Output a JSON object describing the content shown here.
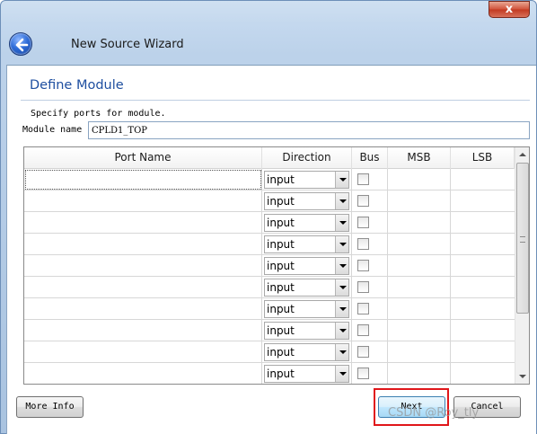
{
  "window": {
    "close_label": "x"
  },
  "wizard": {
    "title": "New Source Wizard"
  },
  "page": {
    "heading": "Define Module",
    "description": "Specify ports for module.",
    "module_name_label": "Module name",
    "module_name_value": "CPLD1_TOP"
  },
  "table": {
    "headers": [
      "Port Name",
      "Direction",
      "Bus",
      "MSB",
      "LSB"
    ],
    "rows": [
      {
        "port_name": "",
        "direction": "input",
        "bus": false,
        "msb": "",
        "lsb": ""
      },
      {
        "port_name": "",
        "direction": "input",
        "bus": false,
        "msb": "",
        "lsb": ""
      },
      {
        "port_name": "",
        "direction": "input",
        "bus": false,
        "msb": "",
        "lsb": ""
      },
      {
        "port_name": "",
        "direction": "input",
        "bus": false,
        "msb": "",
        "lsb": ""
      },
      {
        "port_name": "",
        "direction": "input",
        "bus": false,
        "msb": "",
        "lsb": ""
      },
      {
        "port_name": "",
        "direction": "input",
        "bus": false,
        "msb": "",
        "lsb": ""
      },
      {
        "port_name": "",
        "direction": "input",
        "bus": false,
        "msb": "",
        "lsb": ""
      },
      {
        "port_name": "",
        "direction": "input",
        "bus": false,
        "msb": "",
        "lsb": ""
      },
      {
        "port_name": "",
        "direction": "input",
        "bus": false,
        "msb": "",
        "lsb": ""
      },
      {
        "port_name": "",
        "direction": "input",
        "bus": false,
        "msb": "",
        "lsb": ""
      }
    ]
  },
  "buttons": {
    "more_info": "More Info",
    "next": "Next",
    "cancel": "Cancel"
  },
  "watermark": "CSDN @Roy_tly",
  "colors": {
    "heading": "#1f4fa0",
    "highlight": "#e0161a",
    "back_button": "#2d6cd8"
  }
}
